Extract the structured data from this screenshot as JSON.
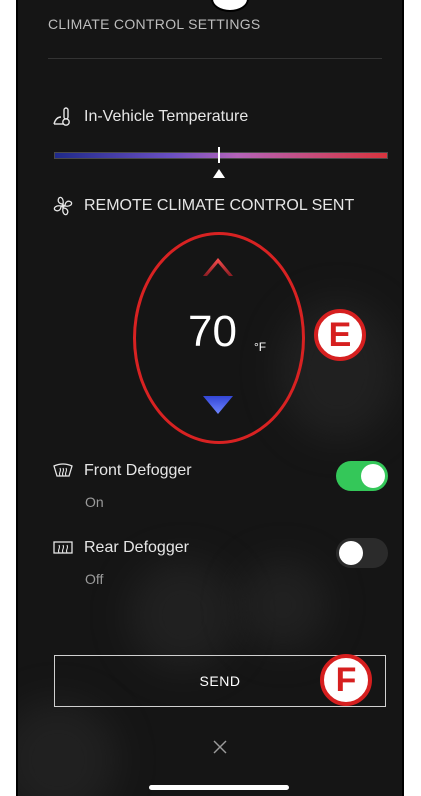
{
  "header": {
    "title": "CLIMATE CONTROL SETTINGS"
  },
  "in_vehicle_temperature": {
    "label": "In-Vehicle Temperature",
    "icon": "thermometer-icon"
  },
  "remote_climate": {
    "status_label": "REMOTE CLIMATE CONTROL SENT",
    "icon": "fan-icon"
  },
  "setpoint": {
    "value": "70",
    "unit": "°F"
  },
  "front_defogger": {
    "label": "Front Defogger",
    "status": "On",
    "toggle_on": true,
    "icon": "front-defogger-icon"
  },
  "rear_defogger": {
    "label": "Rear Defogger",
    "status": "Off",
    "toggle_on": false,
    "icon": "rear-defogger-icon"
  },
  "send": {
    "label": "SEND"
  },
  "callouts": {
    "e": "E",
    "f": "F"
  },
  "colors": {
    "background": "#151515",
    "accent_red": "#d82222",
    "toggle_on": "#34c759",
    "arrow_up": "#b3262e",
    "arrow_down": "#2b3cb8"
  }
}
